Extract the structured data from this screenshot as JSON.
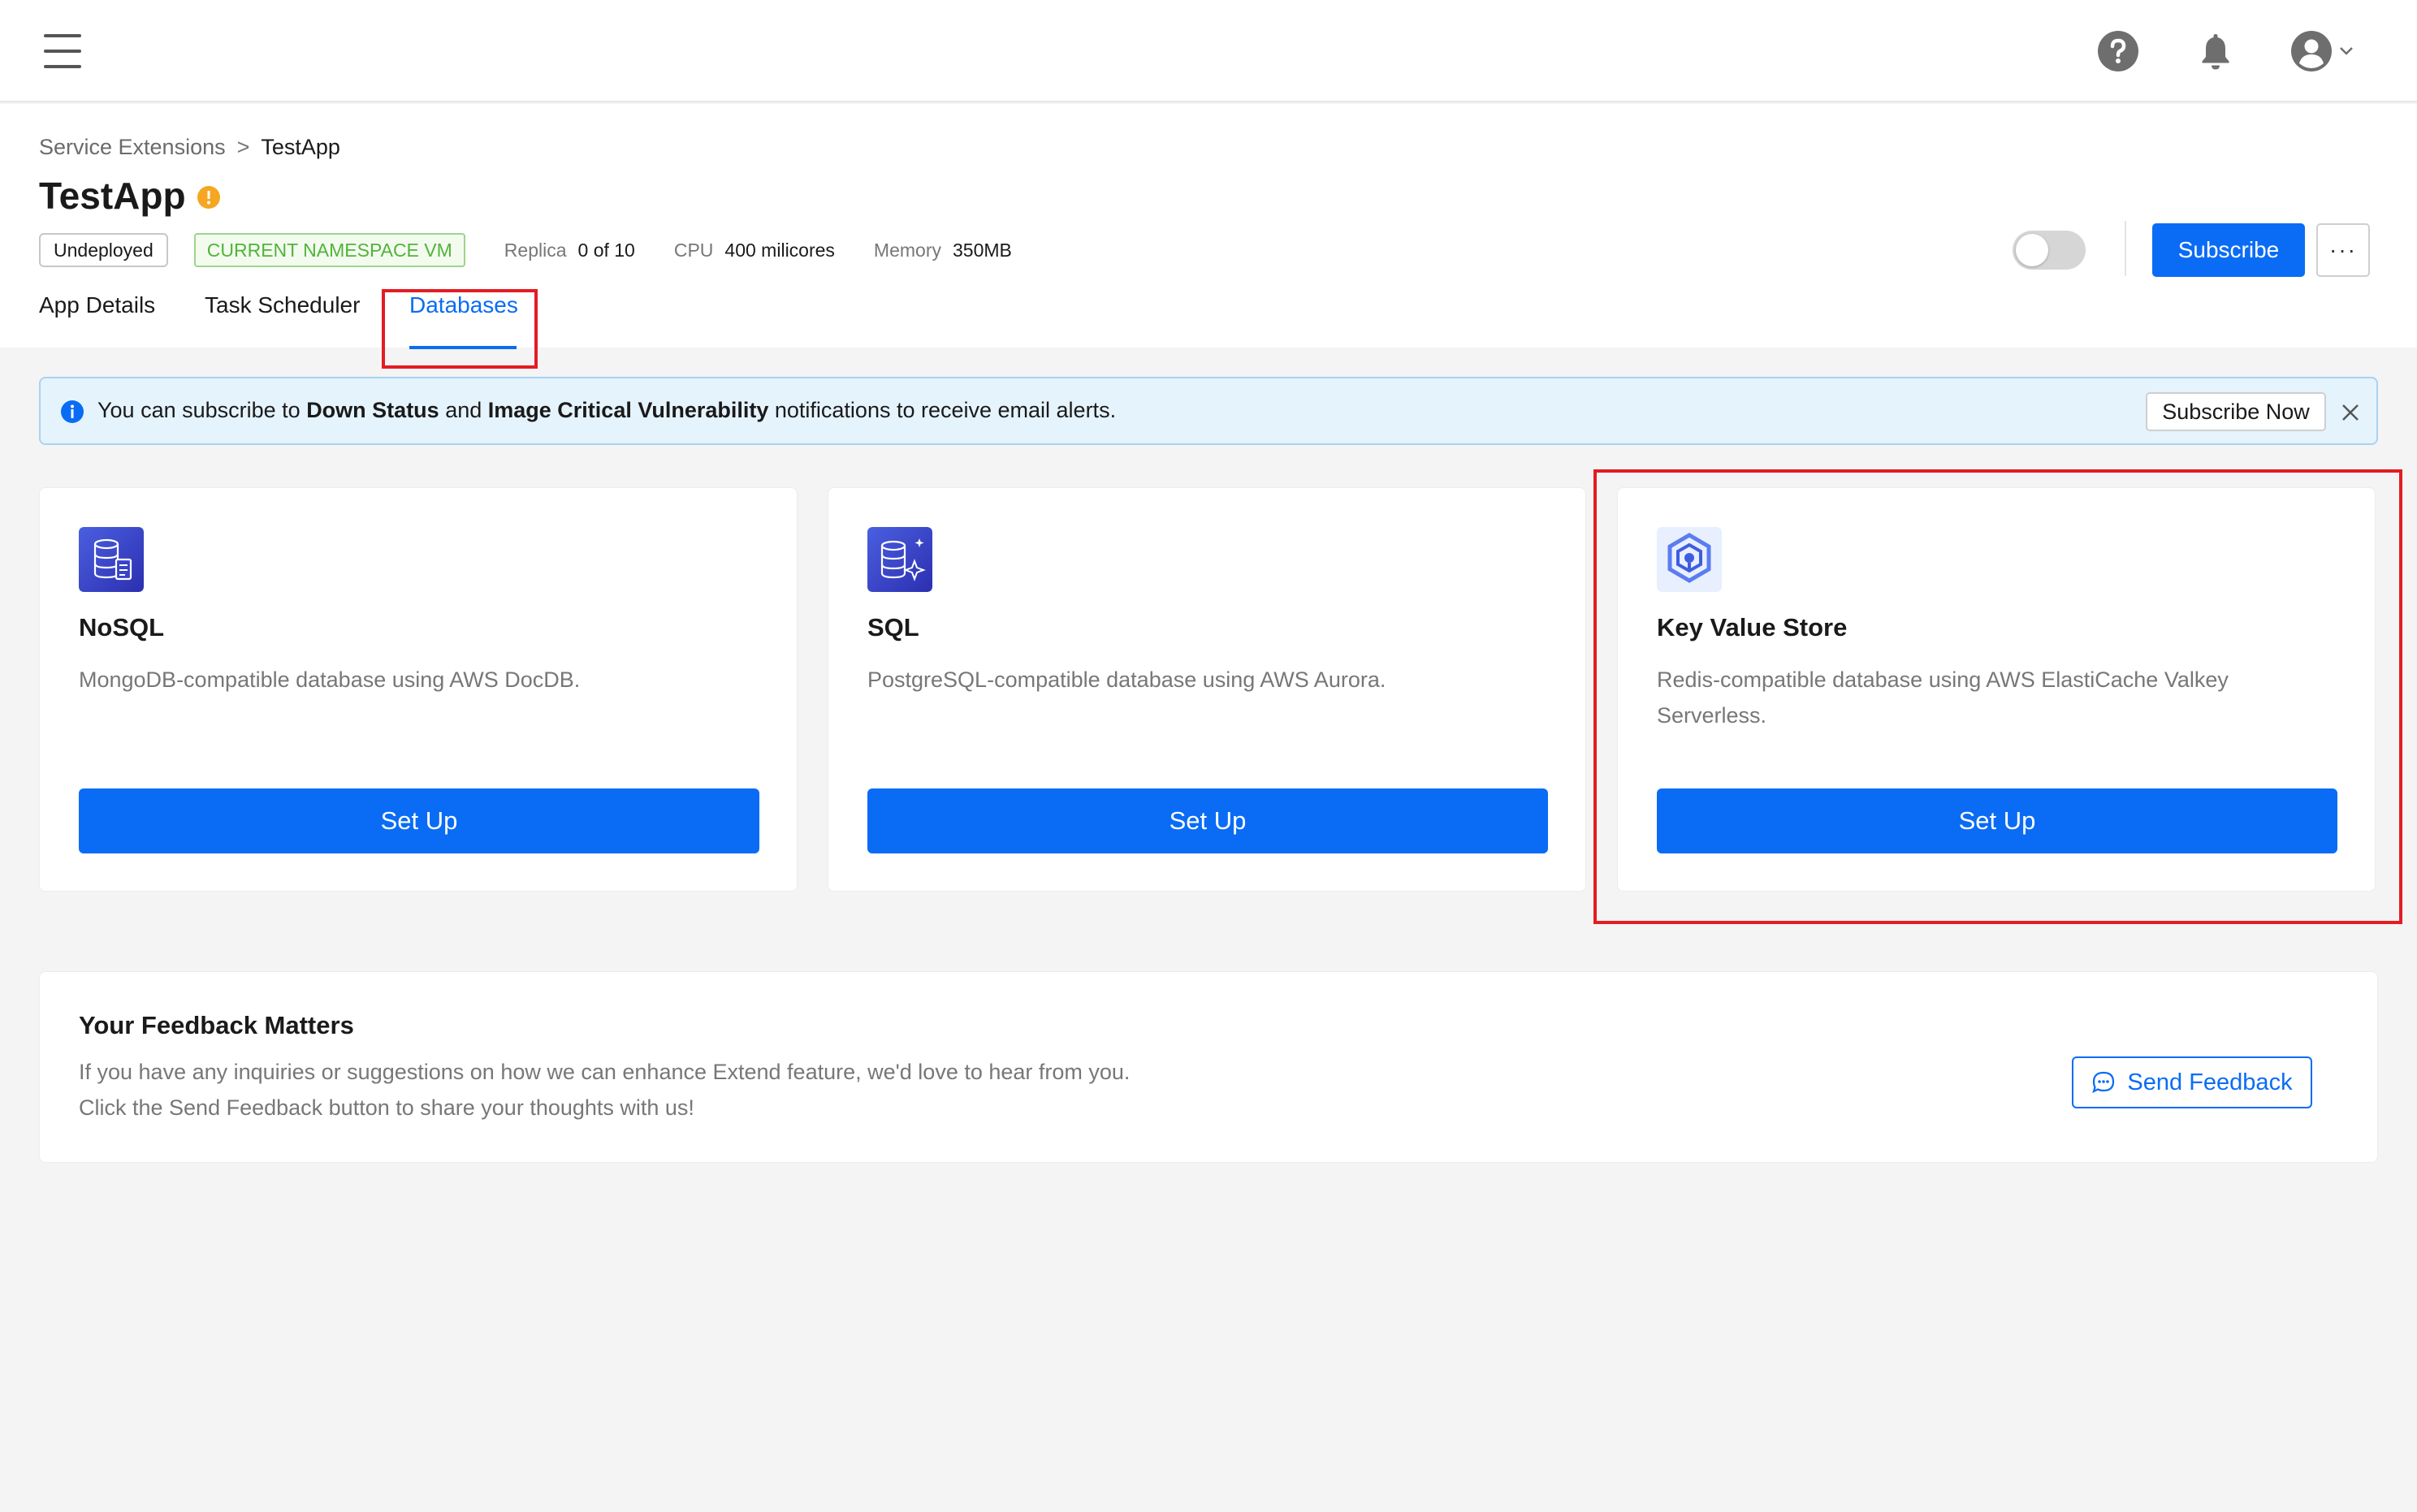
{
  "topbar": {
    "menu_icon": "hamburger-menu-icon",
    "help_icon": "question-circle-icon",
    "bell_icon": "bell-icon",
    "avatar_icon": "user-avatar-icon",
    "chevron_icon": "chevron-down-icon"
  },
  "breadcrumb": {
    "parent": "Service Extensions",
    "separator": ">",
    "current": "TestApp"
  },
  "app": {
    "title": "TestApp",
    "status_badge": "Undeployed",
    "namespace_badge": "CURRENT NAMESPACE VM",
    "replica_label": "Replica",
    "replica_value": "0 of 10",
    "cpu_label": "CPU",
    "cpu_value": "400 milicores",
    "memory_label": "Memory",
    "memory_value": "350MB"
  },
  "actions": {
    "toggle_on": false,
    "subscribe_label": "Subscribe",
    "more_label": "···"
  },
  "tabs": [
    {
      "label": "App Details",
      "active": false
    },
    {
      "label": "Task Scheduler",
      "active": false
    },
    {
      "label": "Databases",
      "active": true
    }
  ],
  "alert": {
    "text_1": "You can subscribe to ",
    "bold_1": "Down Status",
    "text_2": " and ",
    "bold_2": "Image Critical Vulnerability",
    "text_3": " notifications to receive email alerts.",
    "subscribe_now_label": "Subscribe Now"
  },
  "cards": [
    {
      "title": "NoSQL",
      "description": "MongoDB-compatible database using AWS DocDB.",
      "button": "Set Up",
      "icon": "nosql-database-icon"
    },
    {
      "title": "SQL",
      "description": "PostgreSQL-compatible database using AWS Aurora.",
      "button": "Set Up",
      "icon": "sql-database-icon"
    },
    {
      "title": "Key Value Store",
      "description": "Redis-compatible database using AWS ElastiCache Valkey Serverless.",
      "button": "Set Up",
      "icon": "key-value-store-icon"
    }
  ],
  "feedback": {
    "title": "Your Feedback Matters",
    "line_1": "If you have any inquiries or suggestions on how we can enhance Extend feature, we'd love to hear from you.",
    "line_2": "Click the Send Feedback button to share your thoughts with us!",
    "button": "Send Feedback"
  },
  "colors": {
    "primary": "#0a6cf5",
    "highlight_border": "#e31c23",
    "namespace_green": "#52b33a",
    "warning_orange": "#f5a623",
    "alert_bg": "#e5f3fd"
  }
}
